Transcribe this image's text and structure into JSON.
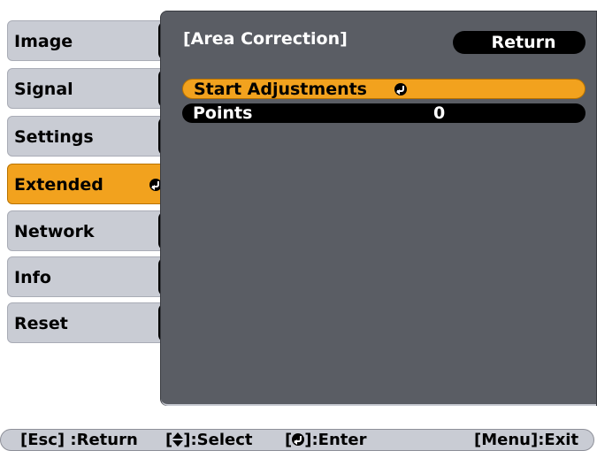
{
  "sidebar": {
    "items": [
      {
        "label": "Image"
      },
      {
        "label": "Signal"
      },
      {
        "label": "Settings"
      },
      {
        "label": "Extended"
      },
      {
        "label": "Network"
      },
      {
        "label": "Info"
      },
      {
        "label": "Reset"
      }
    ],
    "active_index": 3,
    "active_icon": "enter-icon"
  },
  "panel": {
    "title": "[Area Correction]",
    "return_label": "Return",
    "rows": [
      {
        "label": "Start Adjustments",
        "icon": "enter-icon",
        "selected": true
      },
      {
        "label": "Points",
        "value": "0",
        "selected": false
      }
    ]
  },
  "help_bar": {
    "esc": "[Esc] :Return",
    "select_prefix": "[",
    "select_icon": "up-down-arrows-icon",
    "select_suffix": "]:Select",
    "enter_prefix": "[",
    "enter_icon": "enter-icon",
    "enter_suffix": "]:Enter",
    "menu": "[Menu]:Exit"
  },
  "colors": {
    "highlight": "#f2a21e",
    "panel_bg": "#5a5d64",
    "tab_bg": "#c9ccd4"
  }
}
